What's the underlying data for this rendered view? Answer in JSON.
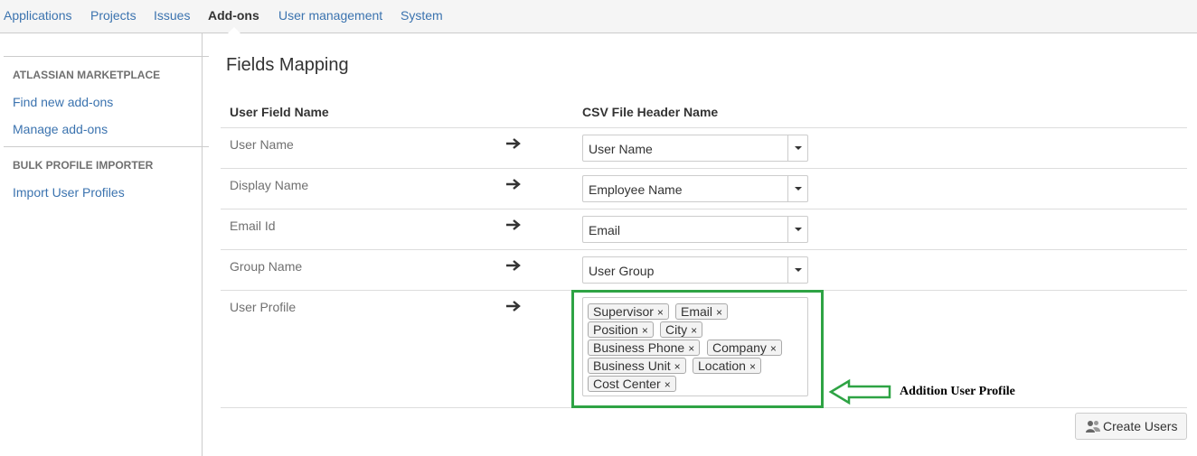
{
  "topnav": {
    "items": [
      {
        "label": "Applications"
      },
      {
        "label": "Projects"
      },
      {
        "label": "Issues"
      },
      {
        "label": "Add-ons",
        "active": true
      },
      {
        "label": "User management"
      },
      {
        "label": "System"
      }
    ]
  },
  "sidebar": {
    "sections": [
      {
        "heading": "ATLASSIAN MARKETPLACE",
        "links": [
          "Find new add-ons",
          "Manage add-ons"
        ]
      },
      {
        "heading": "BULK PROFILE IMPORTER",
        "links": [
          "Import User Profiles"
        ]
      }
    ]
  },
  "main": {
    "title": "Fields Mapping",
    "columns": {
      "user_field": "User Field Name",
      "csv_header": "CSV File Header Name"
    },
    "rows": [
      {
        "field": "User Name",
        "selected": "User Name"
      },
      {
        "field": "Display Name",
        "selected": "Employee Name"
      },
      {
        "field": "Email Id",
        "selected": "Email"
      },
      {
        "field": "Group Name",
        "selected": "User Group"
      },
      {
        "field": "User Profile"
      }
    ],
    "profile_tags": [
      "Supervisor",
      "Email",
      "Position",
      "City",
      "Business Phone",
      "Company",
      "Business Unit",
      "Location",
      "Cost Center"
    ],
    "tag_remove_glyph": "×",
    "annotation": {
      "text": "Addition User Profile",
      "color": "#2ea344"
    },
    "create_button": {
      "label": "Create Users",
      "icon": "users-icon"
    }
  },
  "colors": {
    "link": "#3b73af",
    "highlight": "#2ea344",
    "text": "#333333"
  }
}
